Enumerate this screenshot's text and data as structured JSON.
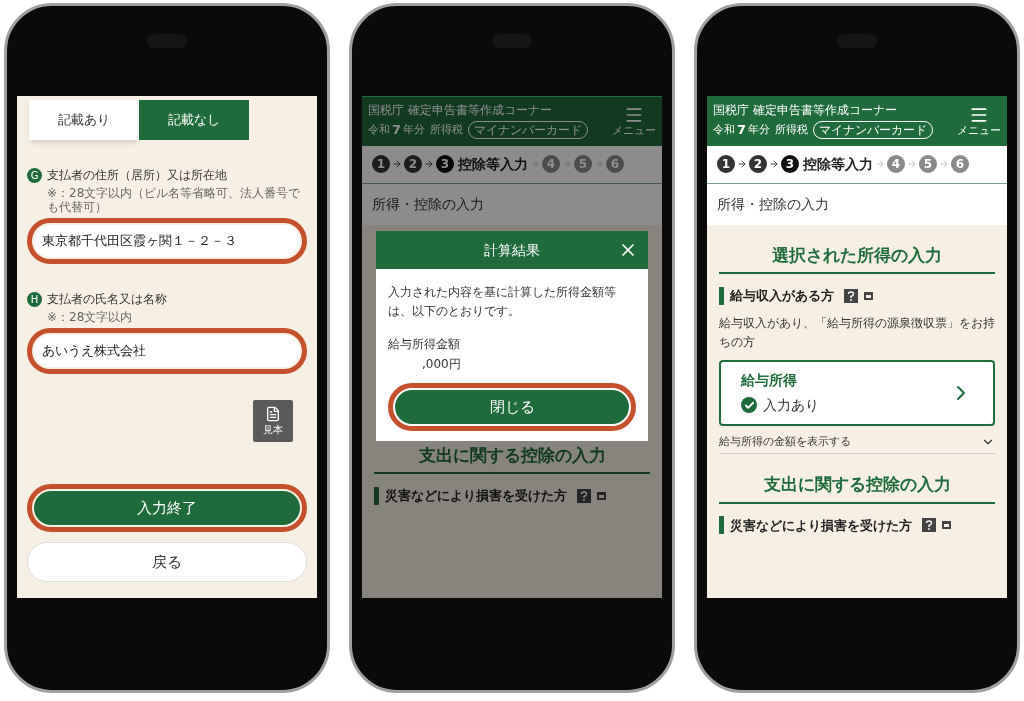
{
  "phones": [
    {
      "kind": "form",
      "dimmed": false,
      "toggle": [
        {
          "label": "記載あり",
          "selected": false
        },
        {
          "label": "記載なし",
          "selected": true
        }
      ],
      "fields": [
        {
          "badge": "G",
          "label": "支払者の住所（居所）又は所在地",
          "note": "※：28文字以内（ビル名等省略可、法人番号でも代替可）",
          "value": "東京都千代田区霞ヶ関１－２－３",
          "highlighted": true
        },
        {
          "badge": "H",
          "label": "支払者の氏名又は名称",
          "note": "※：28文字以内",
          "value": "あいうえ株式会社",
          "highlighted": true
        }
      ],
      "sample_button": "見本",
      "buttons": [
        {
          "label": "入力終了",
          "kind": "primary",
          "highlighted": true
        },
        {
          "label": "戻る",
          "kind": "secondary",
          "highlighted": false
        }
      ]
    },
    {
      "kind": "income",
      "dimmed": true,
      "header": {
        "title": "国税庁 確定申告書等作成コーナー",
        "era": "令和",
        "year": "7",
        "year_suffix": "年分",
        "tax": "所得税",
        "card_button": "マイナンバーカード",
        "menu": "メニュー"
      },
      "steps": [
        {
          "number": "1",
          "done": true,
          "current": false
        },
        {
          "number": "2",
          "done": true,
          "current": false
        },
        {
          "number": "3",
          "done": false,
          "current": true,
          "label": "控除等入力"
        },
        {
          "number": "4",
          "done": false,
          "current": false
        },
        {
          "number": "5",
          "done": false,
          "current": false
        },
        {
          "number": "6",
          "done": false,
          "current": false
        }
      ],
      "page_title": "所得・控除の入力",
      "modal": {
        "title": "計算結果",
        "message": "入力された内容を基に計算した所得金額等は、以下のとおりです。",
        "amount_label": "給与所得金額",
        "amount": ",000円",
        "button": "閉じる",
        "highlighted": true
      },
      "sections": [
        {
          "heading": "支出に関する控除の入力",
          "groups": [
            {
              "title": "災害などにより損害を受けた方"
            }
          ]
        }
      ]
    },
    {
      "kind": "income",
      "dimmed": false,
      "header": {
        "title": "国税庁 確定申告書等作成コーナー",
        "era": "令和",
        "year": "7",
        "year_suffix": "年分",
        "tax": "所得税",
        "card_button": "マイナンバーカード",
        "menu": "メニュー"
      },
      "steps": [
        {
          "number": "1",
          "done": true,
          "current": false
        },
        {
          "number": "2",
          "done": true,
          "current": false
        },
        {
          "number": "3",
          "done": false,
          "current": true,
          "label": "控除等入力"
        },
        {
          "number": "4",
          "done": false,
          "current": false
        },
        {
          "number": "5",
          "done": false,
          "current": false
        },
        {
          "number": "6",
          "done": false,
          "current": false
        }
      ],
      "page_title": "所得・控除の入力",
      "sections": [
        {
          "heading": "選択された所得の入力",
          "groups": [
            {
              "title": "給与収入がある方",
              "description": "給与収入があり、「給与所得の源泉徴収票」をお持ちの方",
              "card": {
                "title": "給与所得",
                "status": "入力あり",
                "done": true
              },
              "expander": "給与所得の金額を表示する"
            }
          ]
        },
        {
          "heading": "支出に関する控除の入力",
          "groups": [
            {
              "title": "災害などにより損害を受けた方"
            }
          ]
        }
      ]
    }
  ]
}
